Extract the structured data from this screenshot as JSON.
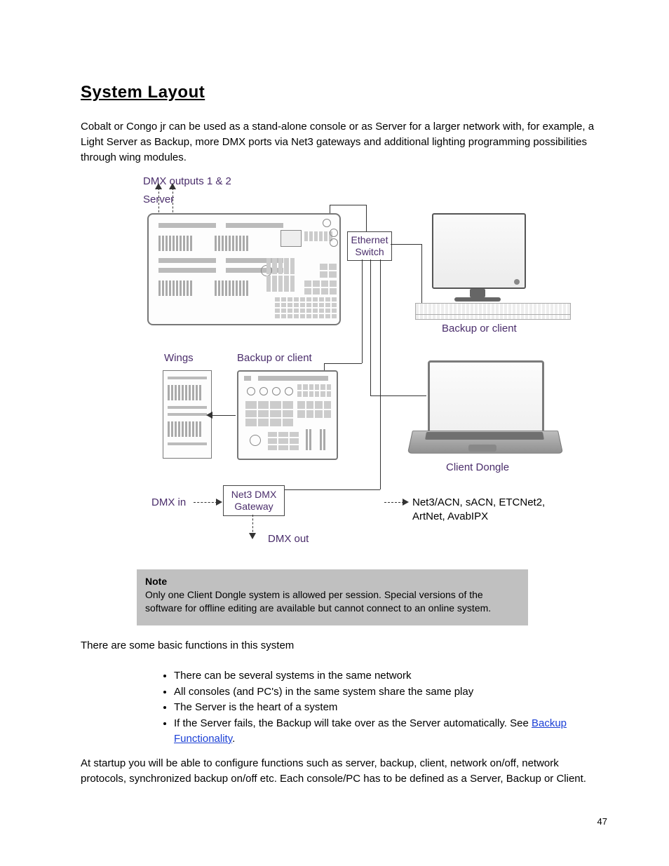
{
  "heading": "System Layout",
  "intro": "Cobalt or Congo jr can be used as a stand-alone console or as Server for a larger network with, for example, a Light Server as Backup, more DMX ports via Net3 gateways and additional lighting programming possibilities through wing modules.",
  "diagram": {
    "dmx_outputs": "DMX outputs 1 & 2",
    "server": "Server",
    "ethernet_switch": [
      "Ethernet",
      "Switch"
    ],
    "backup_or_client_top": "Backup or client",
    "wings": "Wings",
    "backup_or_client_mid": "Backup or client",
    "client_dongle": "Client Dongle",
    "dmx_in": "DMX in",
    "net3_gateway": [
      "Net3 DMX",
      "Gateway"
    ],
    "dmx_out": "DMX out",
    "protocols": [
      "Net3/ACN, sACN, ETCNet2,",
      "ArtNet, AvabIPX"
    ]
  },
  "note": {
    "label": "Note",
    "body": "Only one Client Dongle system is allowed per session. Special versions of the software for offline editing are available but cannot connect to an online system."
  },
  "bullets_intro": "There are some basic functions in this system",
  "bullets": [
    "There can be several systems in the same network",
    "All consoles (and PC's) in the same system share the same play",
    "The Server is the heart of a system",
    "If the Server fails, the Backup will take over as the Server automatically"
  ],
  "see": {
    "prefix": "See ",
    "link": "Backup Functionality",
    "suffix": "."
  },
  "after_list": "At startup you will be able to configure functions such as server, backup, client, network on/off, network protocols, synchronized backup on/off etc. Each console/PC has to be defined as a Server, Backup or Client.",
  "footer": {
    "left": "",
    "right": "47"
  }
}
